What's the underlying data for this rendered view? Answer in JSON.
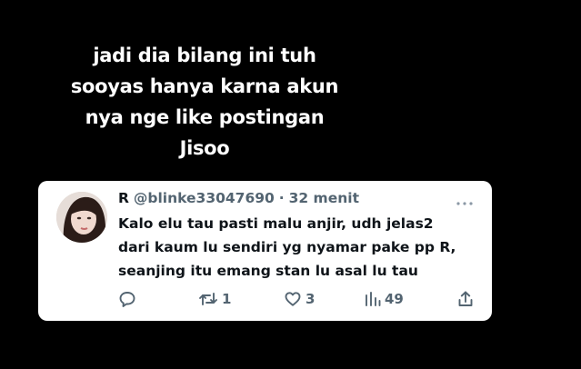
{
  "caption": {
    "lines": [
      "jadi dia bilang ini tuh",
      "sooyas hanya karna akun",
      "nya nge like postingan",
      "Jisoo"
    ]
  },
  "tweet": {
    "display_name": "R",
    "handle": "@blinke33047690",
    "separator": "·",
    "time": "32 menit",
    "text_lines": [
      "Kalo elu tau pasti malu anjir, udh jelas2",
      "dari kaum lu sendiri yg nyamar pake pp R,",
      "seanjing itu emang stan lu asal lu tau"
    ],
    "actions": {
      "reply_count": "",
      "retweet_count": "1",
      "like_count": "3",
      "view_count": "49"
    },
    "icons": {
      "more": "more-horizontal-icon",
      "reply": "reply-icon",
      "retweet": "retweet-icon",
      "like": "heart-icon",
      "views": "views-chart-icon",
      "share": "share-icon"
    }
  },
  "colors": {
    "background": "#000000",
    "caption_text": "#ffffff",
    "card_background": "#ffffff",
    "primary_text": "#0f1419",
    "secondary_text": "#536471"
  }
}
